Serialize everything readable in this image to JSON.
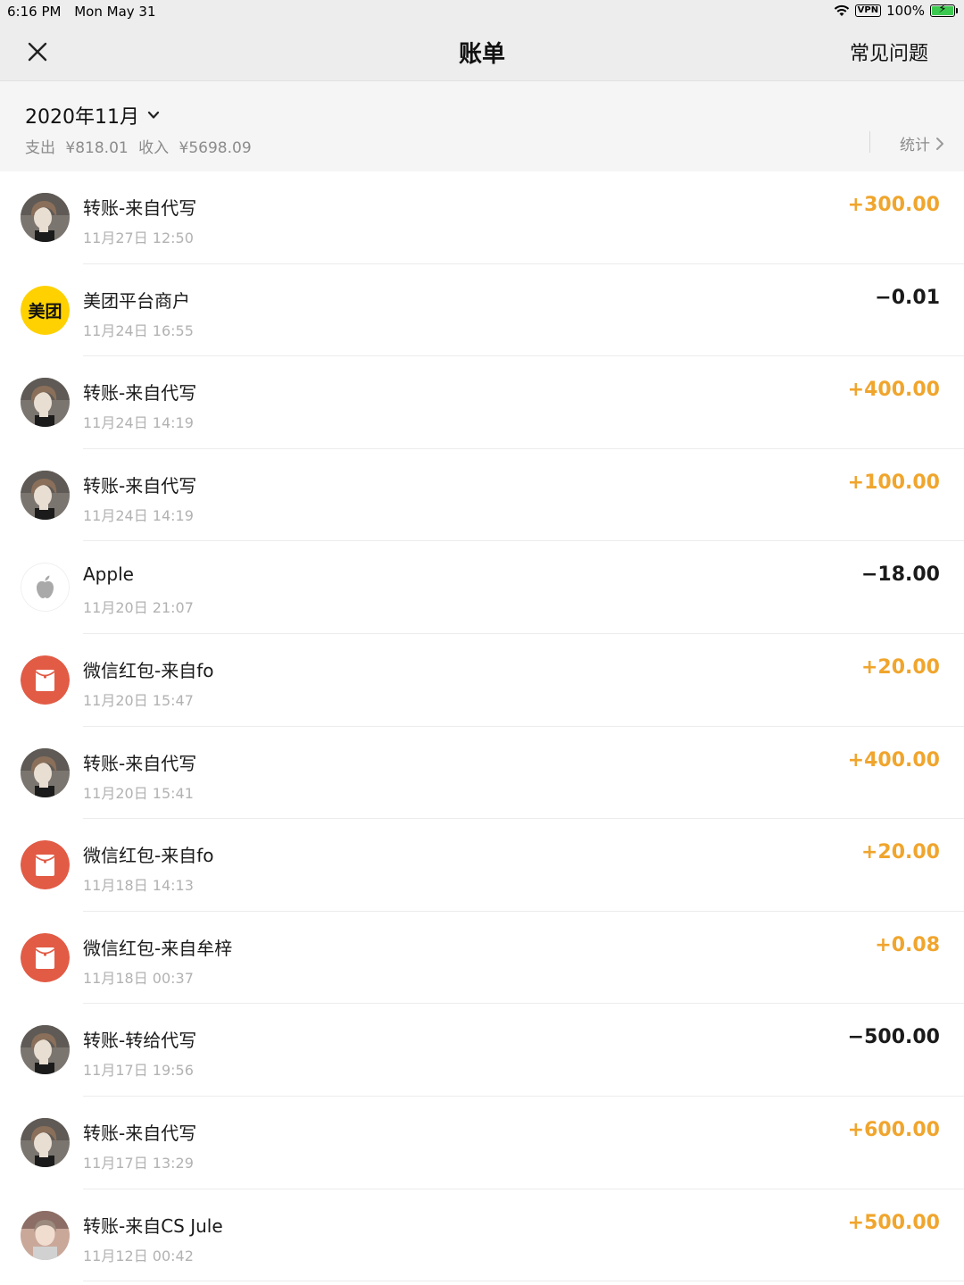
{
  "status_bar": {
    "time": "6:16 PM",
    "date": "Mon May 31",
    "vpn": "VPN",
    "battery": "100%",
    "battery_level": 1.0
  },
  "nav": {
    "title": "账单",
    "help_label": "常见问题",
    "close_icon": "close-icon"
  },
  "month_header": {
    "month": "2020年11月",
    "expense_label": "支出",
    "expense_value": "¥818.01",
    "income_label": "收入",
    "income_value": "¥5698.09",
    "stats_label": "统计"
  },
  "colors": {
    "income": "#f0a52d",
    "expense": "#1a1a1a",
    "meituan": "#ffd100",
    "red_packet": "#e25b45"
  },
  "transactions": [
    {
      "title": "转账-来自代写",
      "time": "11月27日 12:50",
      "amount": "+300.00",
      "type": "income",
      "avatar": "user-avatar"
    },
    {
      "title": "美团平台商户",
      "time": "11月24日 16:55",
      "amount": "−0.01",
      "type": "expense",
      "avatar": "meituan-logo",
      "avatar_text": "美团"
    },
    {
      "title": "转账-来自代写",
      "time": "11月24日 14:19",
      "amount": "+400.00",
      "type": "income",
      "avatar": "user-avatar"
    },
    {
      "title": "转账-来自代写",
      "time": "11月24日 14:19",
      "amount": "+100.00",
      "type": "income",
      "avatar": "user-avatar"
    },
    {
      "title": "Apple",
      "time": "11月20日 21:07",
      "amount": "−18.00",
      "type": "expense",
      "avatar": "apple-logo"
    },
    {
      "title": "微信红包-来自fo",
      "time": "11月20日 15:47",
      "amount": "+20.00",
      "type": "income",
      "avatar": "red-packet-icon"
    },
    {
      "title": "转账-来自代写",
      "time": "11月20日 15:41",
      "amount": "+400.00",
      "type": "income",
      "avatar": "user-avatar"
    },
    {
      "title": "微信红包-来自fo",
      "time": "11月18日 14:13",
      "amount": "+20.00",
      "type": "income",
      "avatar": "red-packet-icon"
    },
    {
      "title": "微信红包-来自牟梓",
      "time": "11月18日 00:37",
      "amount": "+0.08",
      "type": "income",
      "avatar": "red-packet-icon"
    },
    {
      "title": "转账-转给代写",
      "time": "11月17日 19:56",
      "amount": "−500.00",
      "type": "expense",
      "avatar": "user-avatar"
    },
    {
      "title": "转账-来自代写",
      "time": "11月17日 13:29",
      "amount": "+600.00",
      "type": "income",
      "avatar": "user-avatar"
    },
    {
      "title": "转账-来自CS Jule",
      "time": "11月12日 00:42",
      "amount": "+500.00",
      "type": "income",
      "avatar": "user-avatar-alt"
    }
  ]
}
